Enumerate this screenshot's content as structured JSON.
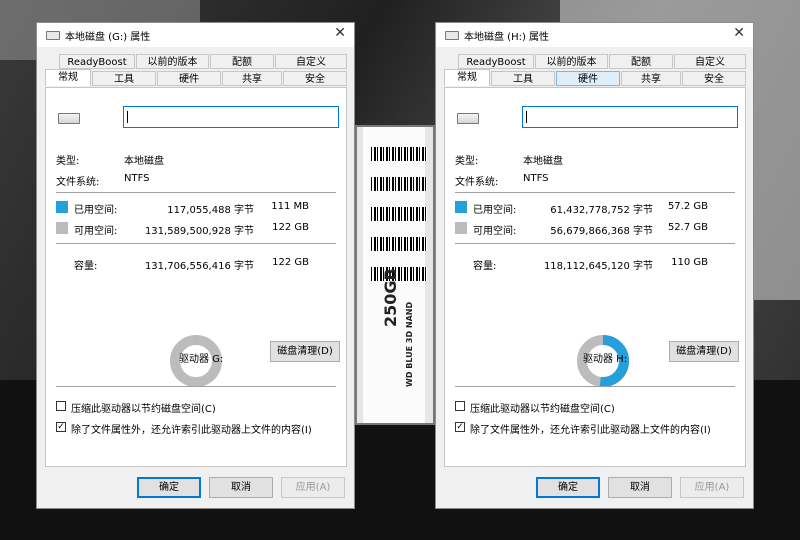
{
  "colors": {
    "used": "#26a0da",
    "free": "#bcbcbc",
    "accent": "#0078d7"
  },
  "icons": {
    "drive": "drive-icon",
    "close": "close-icon"
  },
  "ssd_label": {
    "capacity": "250GB",
    "model": "WD BLUE 3D NAND"
  },
  "dialogs": [
    {
      "title": "本地磁盘 (G:) 属性",
      "tabs_row1": [
        "ReadyBoost",
        "以前的版本",
        "配额",
        "自定义"
      ],
      "tabs_row2": [
        "常规",
        "工具",
        "硬件",
        "共享",
        "安全"
      ],
      "active_tab": "常规",
      "hover_tab": "",
      "name_value": "",
      "type_label": "类型:",
      "type_value": "本地磁盘",
      "fs_label": "文件系统:",
      "fs_value": "NTFS",
      "used_label": "已用空间:",
      "used_bytes": "117,055,488 字节",
      "used_size": "111 MB",
      "free_label": "可用空间:",
      "free_bytes": "131,589,500,928 字节",
      "free_size": "122 GB",
      "cap_label": "容量:",
      "cap_bytes": "131,706,556,416 字节",
      "cap_size": "122 GB",
      "used_fraction": 0.0009,
      "drive_label": "驱动器 G:",
      "cleanup_button": "磁盘清理(D)",
      "compress_label": "压缩此驱动器以节约磁盘空间(C)",
      "compress_checked": false,
      "index_label": "除了文件属性外，还允许索引此驱动器上文件的内容(I)",
      "index_checked": true,
      "ok": "确定",
      "cancel": "取消",
      "apply": "应用(A)"
    },
    {
      "title": "本地磁盘 (H:) 属性",
      "tabs_row1": [
        "ReadyBoost",
        "以前的版本",
        "配额",
        "自定义"
      ],
      "tabs_row2": [
        "常规",
        "工具",
        "硬件",
        "共享",
        "安全"
      ],
      "active_tab": "常规",
      "hover_tab": "硬件",
      "name_value": "",
      "type_label": "类型:",
      "type_value": "本地磁盘",
      "fs_label": "文件系统:",
      "fs_value": "NTFS",
      "used_label": "已用空间:",
      "used_bytes": "61,432,778,752 字节",
      "used_size": "57.2 GB",
      "free_label": "可用空间:",
      "free_bytes": "56,679,866,368 字节",
      "free_size": "52.7 GB",
      "cap_label": "容量:",
      "cap_bytes": "118,112,645,120 字节",
      "cap_size": "110 GB",
      "used_fraction": 0.52,
      "drive_label": "驱动器 H:",
      "cleanup_button": "磁盘清理(D)",
      "compress_label": "压缩此驱动器以节约磁盘空间(C)",
      "compress_checked": false,
      "index_label": "除了文件属性外，还允许索引此驱动器上文件的内容(I)",
      "index_checked": true,
      "ok": "确定",
      "cancel": "取消",
      "apply": "应用(A)"
    }
  ]
}
